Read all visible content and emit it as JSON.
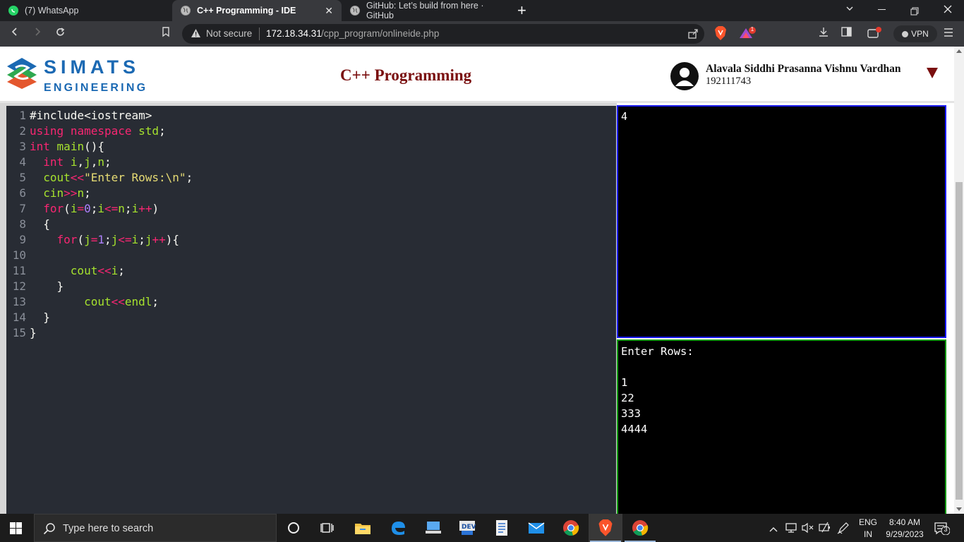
{
  "browser": {
    "tabs": [
      {
        "title": "(7) WhatsApp",
        "active": false
      },
      {
        "title": "C++ Programming - IDE",
        "active": true
      },
      {
        "title": "GitHub: Let’s build from here · GitHub",
        "active": false
      }
    ],
    "address": {
      "security_label": "Not secure",
      "host": "172.18.34.31",
      "path": "/cpp_program/onlineide.php"
    },
    "vpn_label": "VPN",
    "brave_badge": "1"
  },
  "header": {
    "logo_line1": "SIMATS",
    "logo_line2": "ENGINEERING",
    "title": "C++ Programming",
    "user_name": "Alavala Siddhi Prasanna Vishnu Vardhan",
    "user_id": "192111743",
    "colors": {
      "title": "#7a0f0f",
      "logo": "#1b69b3"
    }
  },
  "editor": {
    "lines": [
      {
        "n": "1",
        "t": [
          {
            "c": "def",
            "s": "#include<iostream>"
          }
        ]
      },
      {
        "n": "2",
        "t": [
          {
            "c": "kw",
            "s": "using"
          },
          {
            "c": "def",
            "s": " "
          },
          {
            "c": "kw",
            "s": "namespace"
          },
          {
            "c": "def",
            "s": " "
          },
          {
            "c": "fn",
            "s": "std"
          },
          {
            "c": "def",
            "s": ";"
          }
        ]
      },
      {
        "n": "3",
        "t": [
          {
            "c": "kw",
            "s": "int"
          },
          {
            "c": "def",
            "s": " "
          },
          {
            "c": "fn",
            "s": "main"
          },
          {
            "c": "def",
            "s": "(){"
          }
        ]
      },
      {
        "n": "4",
        "t": [
          {
            "c": "def",
            "s": "  "
          },
          {
            "c": "kw",
            "s": "int"
          },
          {
            "c": "def",
            "s": " "
          },
          {
            "c": "fn",
            "s": "i"
          },
          {
            "c": "def",
            "s": ","
          },
          {
            "c": "fn",
            "s": "j"
          },
          {
            "c": "def",
            "s": ","
          },
          {
            "c": "fn",
            "s": "n"
          },
          {
            "c": "def",
            "s": ";"
          }
        ]
      },
      {
        "n": "5",
        "t": [
          {
            "c": "def",
            "s": "  "
          },
          {
            "c": "fn",
            "s": "cout"
          },
          {
            "c": "kw",
            "s": "<<"
          },
          {
            "c": "str",
            "s": "\"Enter Rows:\\n\""
          },
          {
            "c": "def",
            "s": ";"
          }
        ]
      },
      {
        "n": "6",
        "t": [
          {
            "c": "def",
            "s": "  "
          },
          {
            "c": "fn",
            "s": "cin"
          },
          {
            "c": "kw",
            "s": ">>"
          },
          {
            "c": "fn",
            "s": "n"
          },
          {
            "c": "def",
            "s": ";"
          }
        ]
      },
      {
        "n": "7",
        "t": [
          {
            "c": "def",
            "s": "  "
          },
          {
            "c": "kw",
            "s": "for"
          },
          {
            "c": "def",
            "s": "("
          },
          {
            "c": "fn",
            "s": "i"
          },
          {
            "c": "kw",
            "s": "="
          },
          {
            "c": "num",
            "s": "0"
          },
          {
            "c": "def",
            "s": ";"
          },
          {
            "c": "fn",
            "s": "i"
          },
          {
            "c": "kw",
            "s": "<="
          },
          {
            "c": "fn",
            "s": "n"
          },
          {
            "c": "def",
            "s": ";"
          },
          {
            "c": "fn",
            "s": "i"
          },
          {
            "c": "kw",
            "s": "++"
          },
          {
            "c": "def",
            "s": ")"
          }
        ]
      },
      {
        "n": "8",
        "t": [
          {
            "c": "def",
            "s": "  {"
          }
        ]
      },
      {
        "n": "9",
        "t": [
          {
            "c": "def",
            "s": "    "
          },
          {
            "c": "kw",
            "s": "for"
          },
          {
            "c": "def",
            "s": "("
          },
          {
            "c": "fn",
            "s": "j"
          },
          {
            "c": "kw",
            "s": "="
          },
          {
            "c": "num",
            "s": "1"
          },
          {
            "c": "def",
            "s": ";"
          },
          {
            "c": "fn",
            "s": "j"
          },
          {
            "c": "kw",
            "s": "<="
          },
          {
            "c": "fn",
            "s": "i"
          },
          {
            "c": "def",
            "s": ";"
          },
          {
            "c": "fn",
            "s": "j"
          },
          {
            "c": "kw",
            "s": "++"
          },
          {
            "c": "def",
            "s": "){"
          }
        ]
      },
      {
        "n": "10",
        "t": []
      },
      {
        "n": "11",
        "t": [
          {
            "c": "def",
            "s": "      "
          },
          {
            "c": "fn",
            "s": "cout"
          },
          {
            "c": "kw",
            "s": "<<"
          },
          {
            "c": "fn",
            "s": "i"
          },
          {
            "c": "def",
            "s": ";"
          }
        ]
      },
      {
        "n": "12",
        "t": [
          {
            "c": "def",
            "s": "    }"
          }
        ]
      },
      {
        "n": "13",
        "t": [
          {
            "c": "def",
            "s": "        "
          },
          {
            "c": "fn",
            "s": "cout"
          },
          {
            "c": "kw",
            "s": "<<"
          },
          {
            "c": "fn",
            "s": "endl"
          },
          {
            "c": "def",
            "s": ";"
          }
        ]
      },
      {
        "n": "14",
        "t": [
          {
            "c": "def",
            "s": "  }"
          }
        ]
      },
      {
        "n": "15",
        "t": [
          {
            "c": "def",
            "s": "}"
          }
        ]
      }
    ]
  },
  "io": {
    "input_value": "4",
    "output_text": "Enter Rows:\n\n1\n22\n333\n4444"
  },
  "taskbar": {
    "search_placeholder": "Type here to search",
    "lang_top": "ENG",
    "lang_bottom": "IN",
    "time": "8:40 AM",
    "date": "9/29/2023",
    "notification_count": "3"
  }
}
